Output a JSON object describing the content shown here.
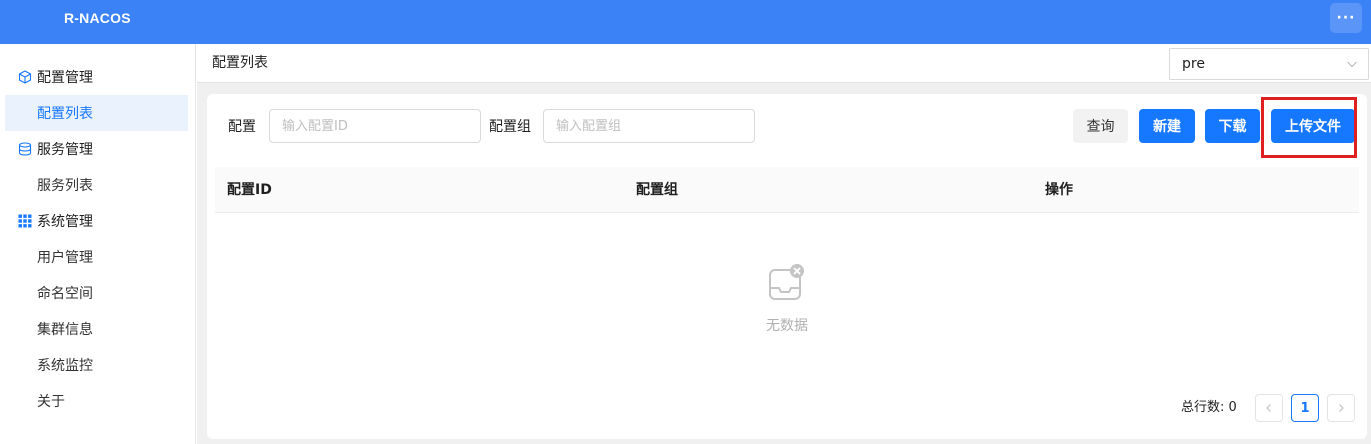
{
  "app": {
    "title": "R-NACOS",
    "more_label": "···"
  },
  "sidebar": {
    "groups": [
      {
        "label": "配置管理",
        "icon": "cube-icon",
        "items": [
          {
            "label": "配置列表",
            "active": true
          }
        ]
      },
      {
        "label": "服务管理",
        "icon": "database-icon",
        "items": [
          {
            "label": "服务列表"
          }
        ]
      },
      {
        "label": "系统管理",
        "icon": "grid-icon",
        "items": [
          {
            "label": "用户管理"
          },
          {
            "label": "命名空间"
          },
          {
            "label": "集群信息"
          },
          {
            "label": "系统监控"
          },
          {
            "label": "关于"
          }
        ]
      }
    ]
  },
  "header": {
    "title": "配置列表",
    "namespace": {
      "value": "pre"
    }
  },
  "filters": {
    "config": {
      "label": "配置",
      "placeholder": "输入配置ID"
    },
    "group": {
      "label": "配置组",
      "placeholder": "输入配置组"
    }
  },
  "actions": {
    "query": "查询",
    "new": "新建",
    "download": "下载",
    "upload": "上传文件"
  },
  "table": {
    "columns": [
      "配置ID",
      "配置组",
      "操作"
    ],
    "rows": [],
    "empty_text": "无数据"
  },
  "pagination": {
    "total_label": "总行数: 0",
    "current_page": "1"
  },
  "colors": {
    "topbar": "#3b82f6",
    "primary": "#1677ff",
    "highlight": "#e02020"
  }
}
